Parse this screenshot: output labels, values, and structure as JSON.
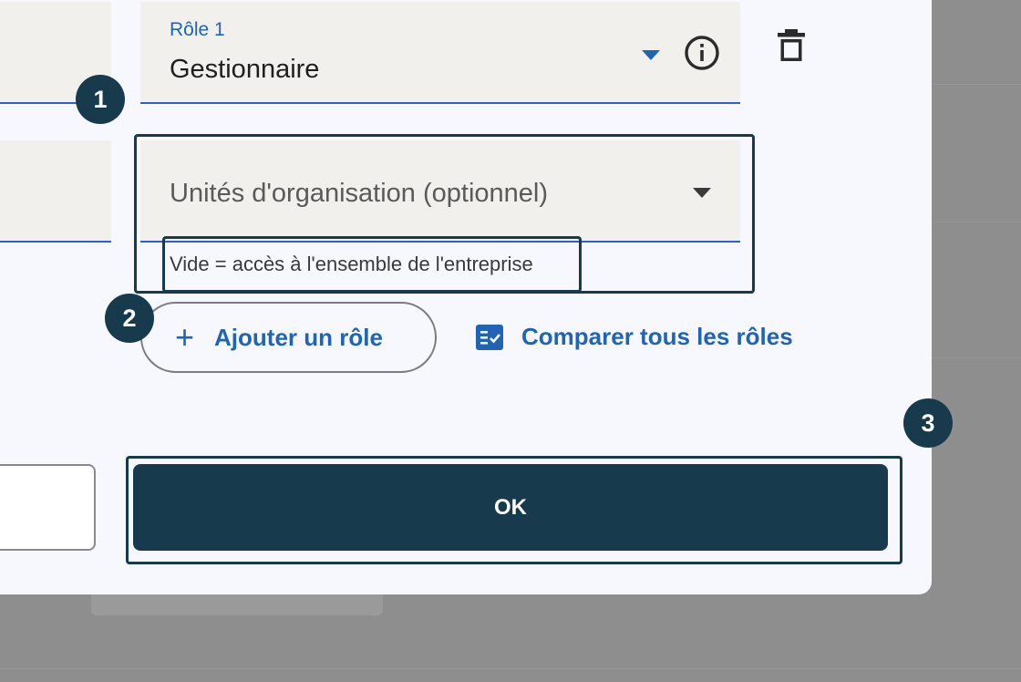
{
  "role_field": {
    "label": "Rôle 1",
    "value": "Gestionnaire"
  },
  "org_units_field": {
    "placeholder": "Unités d'organisation (optionnel)",
    "helper_text": "Vide = accès à l'ensemble de l'entreprise"
  },
  "actions": {
    "add_role_label": "Ajouter un rôle",
    "compare_roles_label": "Comparer tous les rôles",
    "ok_label": "OK"
  },
  "annotations": {
    "step1": "1",
    "step2": "2",
    "step3": "3"
  },
  "icons": {
    "info": "info-circle-icon",
    "delete": "trash-icon",
    "add": "plus-icon",
    "compare": "checklist-icon",
    "dropdown": "caret-down-icon"
  },
  "colors": {
    "accent": "#1f64b5",
    "primary_dark": "#173a4c",
    "field_background": "#f2f0ec",
    "field_underline": "#2f5fcf"
  }
}
